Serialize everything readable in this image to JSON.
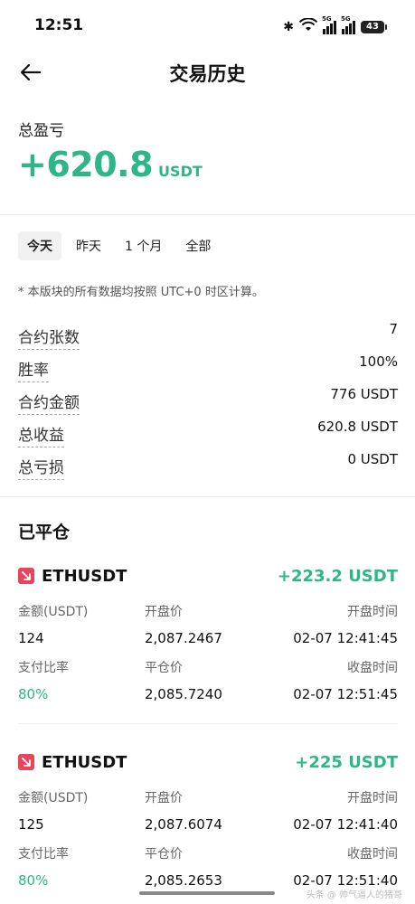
{
  "status_bar": {
    "time": "12:51",
    "signal1": "5G",
    "signal2": "5G",
    "battery": "43"
  },
  "header": {
    "title": "交易历史"
  },
  "pnl": {
    "label": "总盈亏",
    "value": "+620.8",
    "unit": "USDT"
  },
  "tabs": [
    {
      "label": "今天",
      "active": true
    },
    {
      "label": "昨天",
      "active": false
    },
    {
      "label": "1 个月",
      "active": false
    },
    {
      "label": "全部",
      "active": false
    }
  ],
  "note": "* 本版块的所有数据均按照 UTC+0 时区计算。",
  "stats": [
    {
      "label": "合约张数",
      "value": "7"
    },
    {
      "label": "胜率",
      "value": "100%"
    },
    {
      "label": "合约金额",
      "value": "776 USDT"
    },
    {
      "label": "总收益",
      "value": "620.8 USDT"
    },
    {
      "label": "总亏损",
      "value": "0 USDT"
    }
  ],
  "closed": {
    "title": "已平仓",
    "columns": {
      "amount": "金额(USDT)",
      "open_price": "开盘价",
      "open_time": "开盘时间",
      "ratio": "支付比率",
      "close_price": "平仓价",
      "close_time": "收盘时间"
    },
    "trades": [
      {
        "symbol": "ETHUSDT",
        "pnl": "+223.2 USDT",
        "amount": "124",
        "open_price": "2,087.2467",
        "open_time": "02-07 12:41:45",
        "ratio": "80%",
        "close_price": "2,085.7240",
        "close_time": "02-07 12:51:45"
      },
      {
        "symbol": "ETHUSDT",
        "pnl": "+225 USDT",
        "amount": "125",
        "open_price": "2,087.6074",
        "open_time": "02-07 12:41:40",
        "ratio": "80%",
        "close_price": "2,085.2653",
        "close_time": "02-07 12:51:40"
      }
    ]
  },
  "watermark": "头条 @ 帅气逼人的猪哥",
  "colors": {
    "profit": "#2fb58a",
    "short": "#e8455a"
  }
}
